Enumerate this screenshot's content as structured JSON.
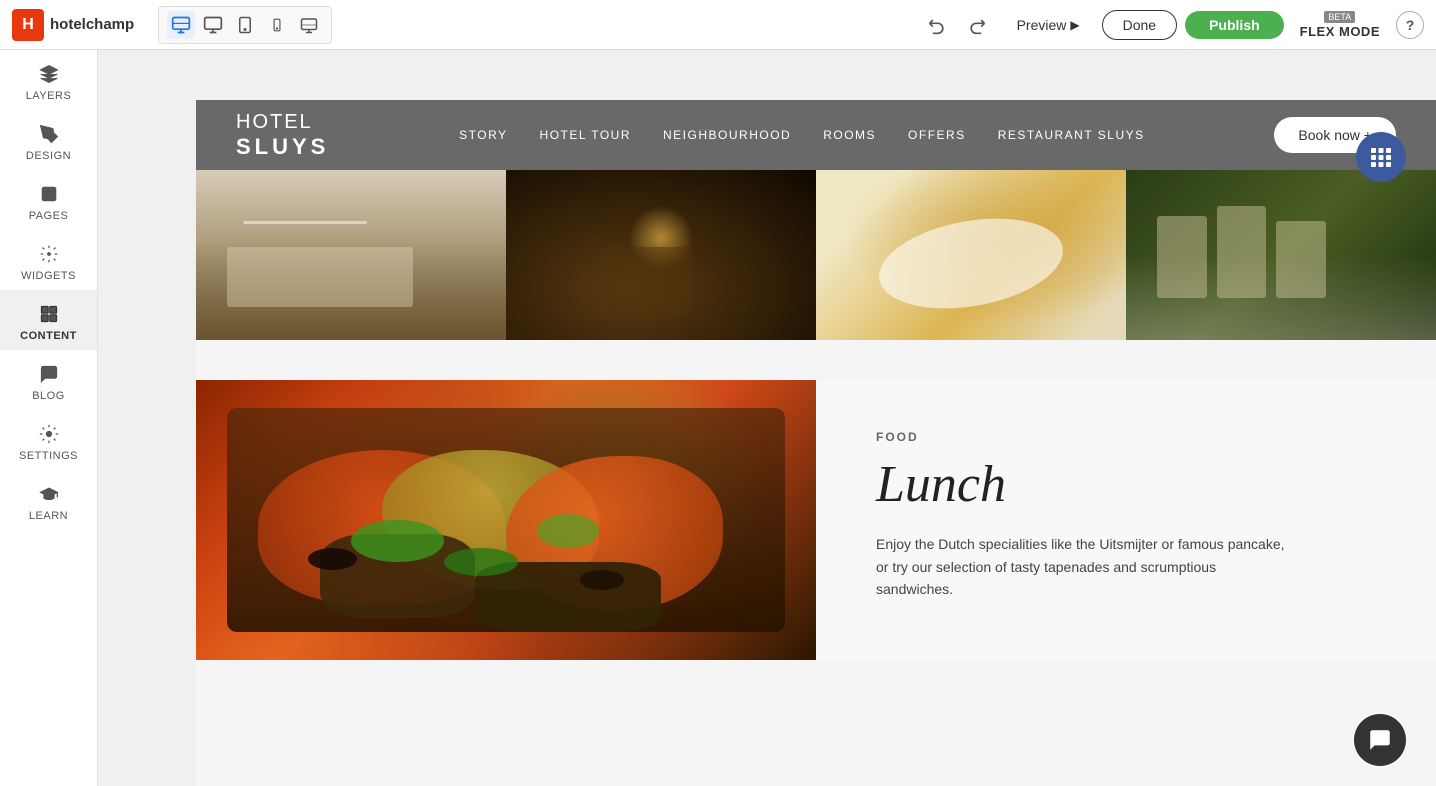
{
  "topbar": {
    "brand_logo": "H",
    "brand_name": "hotelchamp",
    "preview_label": "Preview",
    "done_label": "Done",
    "publish_label": "Publish",
    "flex_mode_label": "FLEX MODE",
    "flex_mode_beta": "BETA",
    "help_label": "?"
  },
  "devices": [
    {
      "id": "desktop-large",
      "icon": "🖥",
      "active": true
    },
    {
      "id": "desktop",
      "icon": "🖥",
      "active": false
    },
    {
      "id": "tablet",
      "icon": "📱",
      "active": false
    },
    {
      "id": "mobile",
      "icon": "📱",
      "active": false
    },
    {
      "id": "tv",
      "icon": "📺",
      "active": false
    }
  ],
  "sidebar": {
    "items": [
      {
        "id": "layers",
        "label": "LAYERS"
      },
      {
        "id": "design",
        "label": "DESIGN"
      },
      {
        "id": "pages",
        "label": "PAGES"
      },
      {
        "id": "widgets",
        "label": "WIDGETS"
      },
      {
        "id": "content",
        "label": "CONTENT",
        "active": true
      },
      {
        "id": "blog",
        "label": "BLOG"
      },
      {
        "id": "settings",
        "label": "SETTINGS"
      },
      {
        "id": "learn",
        "label": "LEARN"
      }
    ]
  },
  "hotel_nav": {
    "logo_top": "HOTEL",
    "logo_bottom": "SLUYS",
    "links": [
      "STORY",
      "HOTEL TOUR",
      "NEIGHBOURHOOD",
      "ROOMS",
      "OFFERS",
      "RESTAURANT SLUYS"
    ],
    "book_btn": "Book now +"
  },
  "food_section": {
    "tag": "FOOD",
    "title": "Lunch",
    "description": "Enjoy the Dutch specialities like the Uitsmijter or famous pancake, or try our selection of tasty tapenades and scrumptious sandwiches."
  }
}
